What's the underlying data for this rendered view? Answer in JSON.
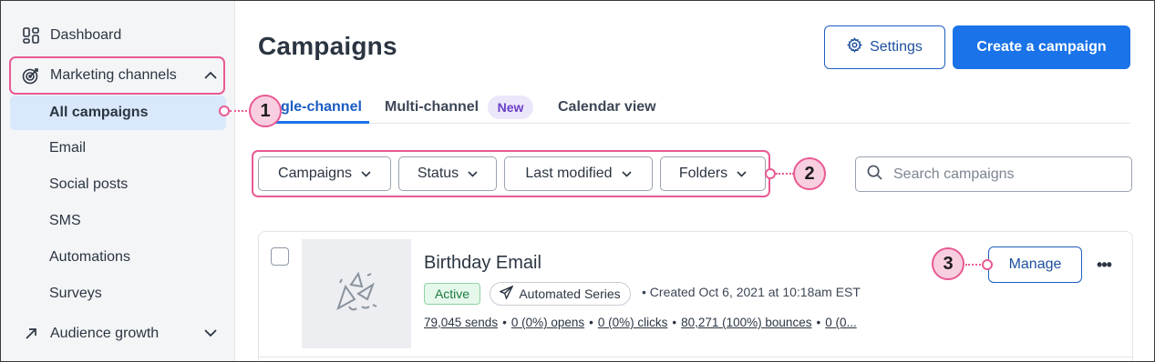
{
  "sidebar": {
    "dashboard": "Dashboard",
    "marketing_channels": "Marketing channels",
    "sub_items": [
      "All campaigns",
      "Email",
      "Social posts",
      "SMS",
      "Automations",
      "Surveys"
    ],
    "audience_growth": "Audience growth"
  },
  "header": {
    "title": "Campaigns",
    "settings_label": "Settings",
    "create_label": "Create a campaign"
  },
  "tabs": {
    "single_channel": "gle-channel",
    "multi_channel": "Multi-channel",
    "new_badge": "New",
    "calendar_view": "Calendar view"
  },
  "filters": {
    "campaigns": "Campaigns",
    "status": "Status",
    "last_modified": "Last modified",
    "folders": "Folders"
  },
  "search": {
    "placeholder": "Search campaigns"
  },
  "campaign": {
    "title": "Birthday Email",
    "status": "Active",
    "type": "Automated Series",
    "created": "• Created Oct 6, 2021 at 10:18am EST",
    "stats": {
      "sends": "79,045 sends",
      "opens": "0 (0%) opens",
      "clicks": "0 (0%) clicks",
      "bounces": "80,271 (100%) bounces",
      "more": "0 (0..."
    },
    "manage_label": "Manage",
    "more_label": "•••"
  },
  "callouts": [
    "1",
    "2",
    "3"
  ],
  "colors": {
    "accent": "#1a73e8",
    "highlight": "#e85a93",
    "active_nav_bg": "#d9e8fb",
    "sidebar_bg": "#f4f5f7"
  }
}
